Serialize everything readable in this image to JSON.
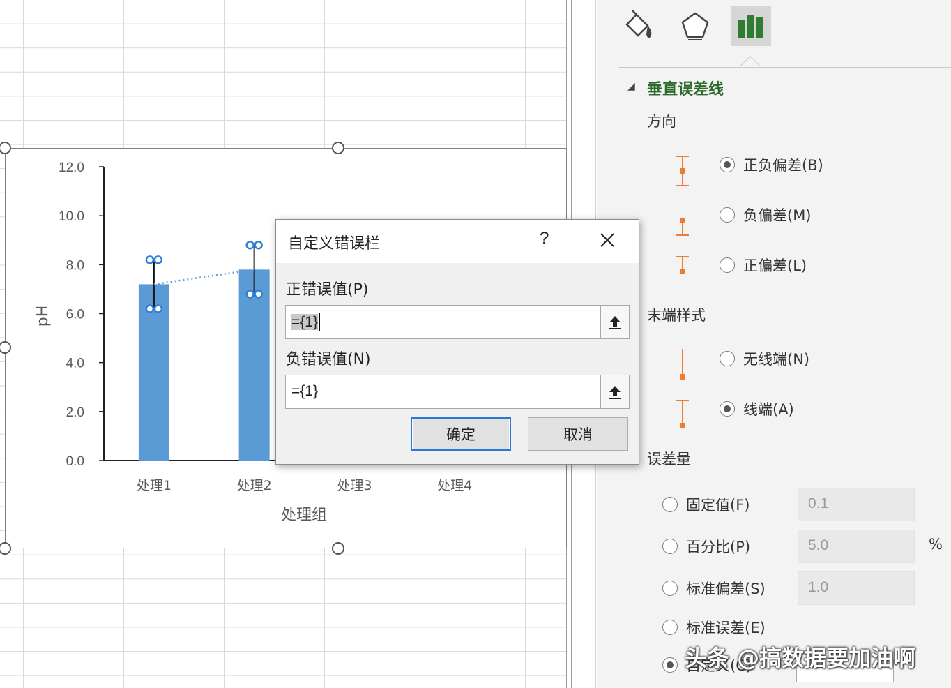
{
  "chart": {
    "y_ticks": [
      "0.0",
      "2.0",
      "4.0",
      "6.0",
      "8.0",
      "10.0",
      "12.0"
    ],
    "ylabel": "pH",
    "xlabel": "处理组",
    "chart_data": {
      "type": "bar",
      "categories": [
        "处理1",
        "处理2",
        "处理3",
        "处理4"
      ],
      "values": [
        7.2,
        7.8,
        null,
        null
      ],
      "error_plus": [
        1,
        1,
        null,
        null
      ],
      "error_minus": [
        1,
        1,
        null,
        null
      ],
      "trendline": "dotted",
      "xlabel": "处理组",
      "ylabel": "pH",
      "ylim": [
        0,
        12
      ],
      "grid": false,
      "bar_color": "#5b9bd5"
    }
  },
  "dialog": {
    "title": "自定义错误栏",
    "help": "?",
    "positive_label": "正错误值(P)",
    "positive_value": "={1}",
    "negative_label": "负错误值(N)",
    "negative_value": "={1}",
    "ok_label": "确定",
    "cancel_label": "取消"
  },
  "pane": {
    "tabs": [
      "fill-line-icon",
      "effects-icon",
      "bar-options-icon"
    ],
    "section_title": "垂直误差线",
    "direction_label": "方向",
    "direction_options": [
      {
        "label": "正负偏差(B)",
        "selected": true
      },
      {
        "label": "负偏差(M)",
        "selected": false
      },
      {
        "label": "正偏差(L)",
        "selected": false
      }
    ],
    "endstyle_label": "末端样式",
    "endstyle_options": [
      {
        "label": "无线端(N)",
        "selected": false
      },
      {
        "label": "线端(A)",
        "selected": true
      }
    ],
    "amount_label": "误差量",
    "amount_options": [
      {
        "label": "固定值(F)",
        "value": "0.1",
        "selected": false
      },
      {
        "label": "百分比(P)",
        "value": "5.0",
        "unit": "%",
        "selected": false
      },
      {
        "label": "标准偏差(S)",
        "value": "1.0",
        "selected": false
      },
      {
        "label": "标准误差(E)",
        "selected": false
      },
      {
        "label": "自定义(C)",
        "selected": true
      }
    ],
    "accent_color": "#ed7d31"
  },
  "watermark": "头条 @搞数据要加油啊"
}
